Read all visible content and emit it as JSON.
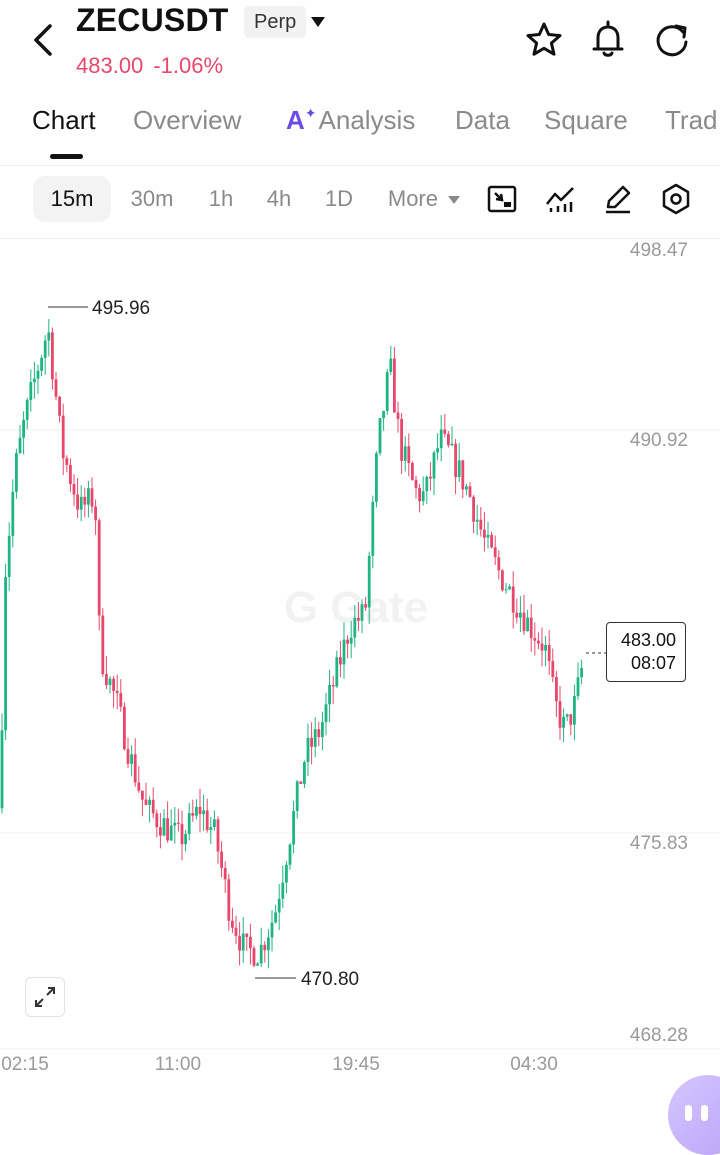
{
  "header": {
    "pair": "ZECUSDT",
    "badge": "Perp",
    "price": "483.00",
    "change": "-1.06%",
    "icons": [
      "back-chevron-icon",
      "star-icon",
      "bell-icon",
      "refresh-icon"
    ],
    "colors": {
      "down": "#e8476c",
      "up": "#1fb484"
    }
  },
  "tabs": [
    {
      "label": "Chart",
      "active": true
    },
    {
      "label": "Overview"
    },
    {
      "label": "Analysis",
      "ai_mark": "A"
    },
    {
      "label": "Data"
    },
    {
      "label": "Square"
    },
    {
      "label": "Trad"
    }
  ],
  "toolbar": {
    "timeframes": [
      "15m",
      "30m",
      "1h",
      "4h",
      "1D"
    ],
    "active_timeframe": "15m",
    "more_label": "More",
    "tools": [
      "indicator-settings-icon",
      "indicators-icon",
      "draw-icon",
      "settings-icon"
    ]
  },
  "chart_data": {
    "type": "candlestick",
    "y_axis_ticks": [
      "498.47",
      "490.92",
      "475.83",
      "468.28"
    ],
    "x_axis_ticks": [
      "02:15",
      "11:00",
      "19:45",
      "04:30"
    ],
    "high_marker": "495.96",
    "low_marker": "470.80",
    "last_price": "483.00",
    "countdown": "08:07",
    "ylim": [
      468.28,
      498.47
    ]
  }
}
